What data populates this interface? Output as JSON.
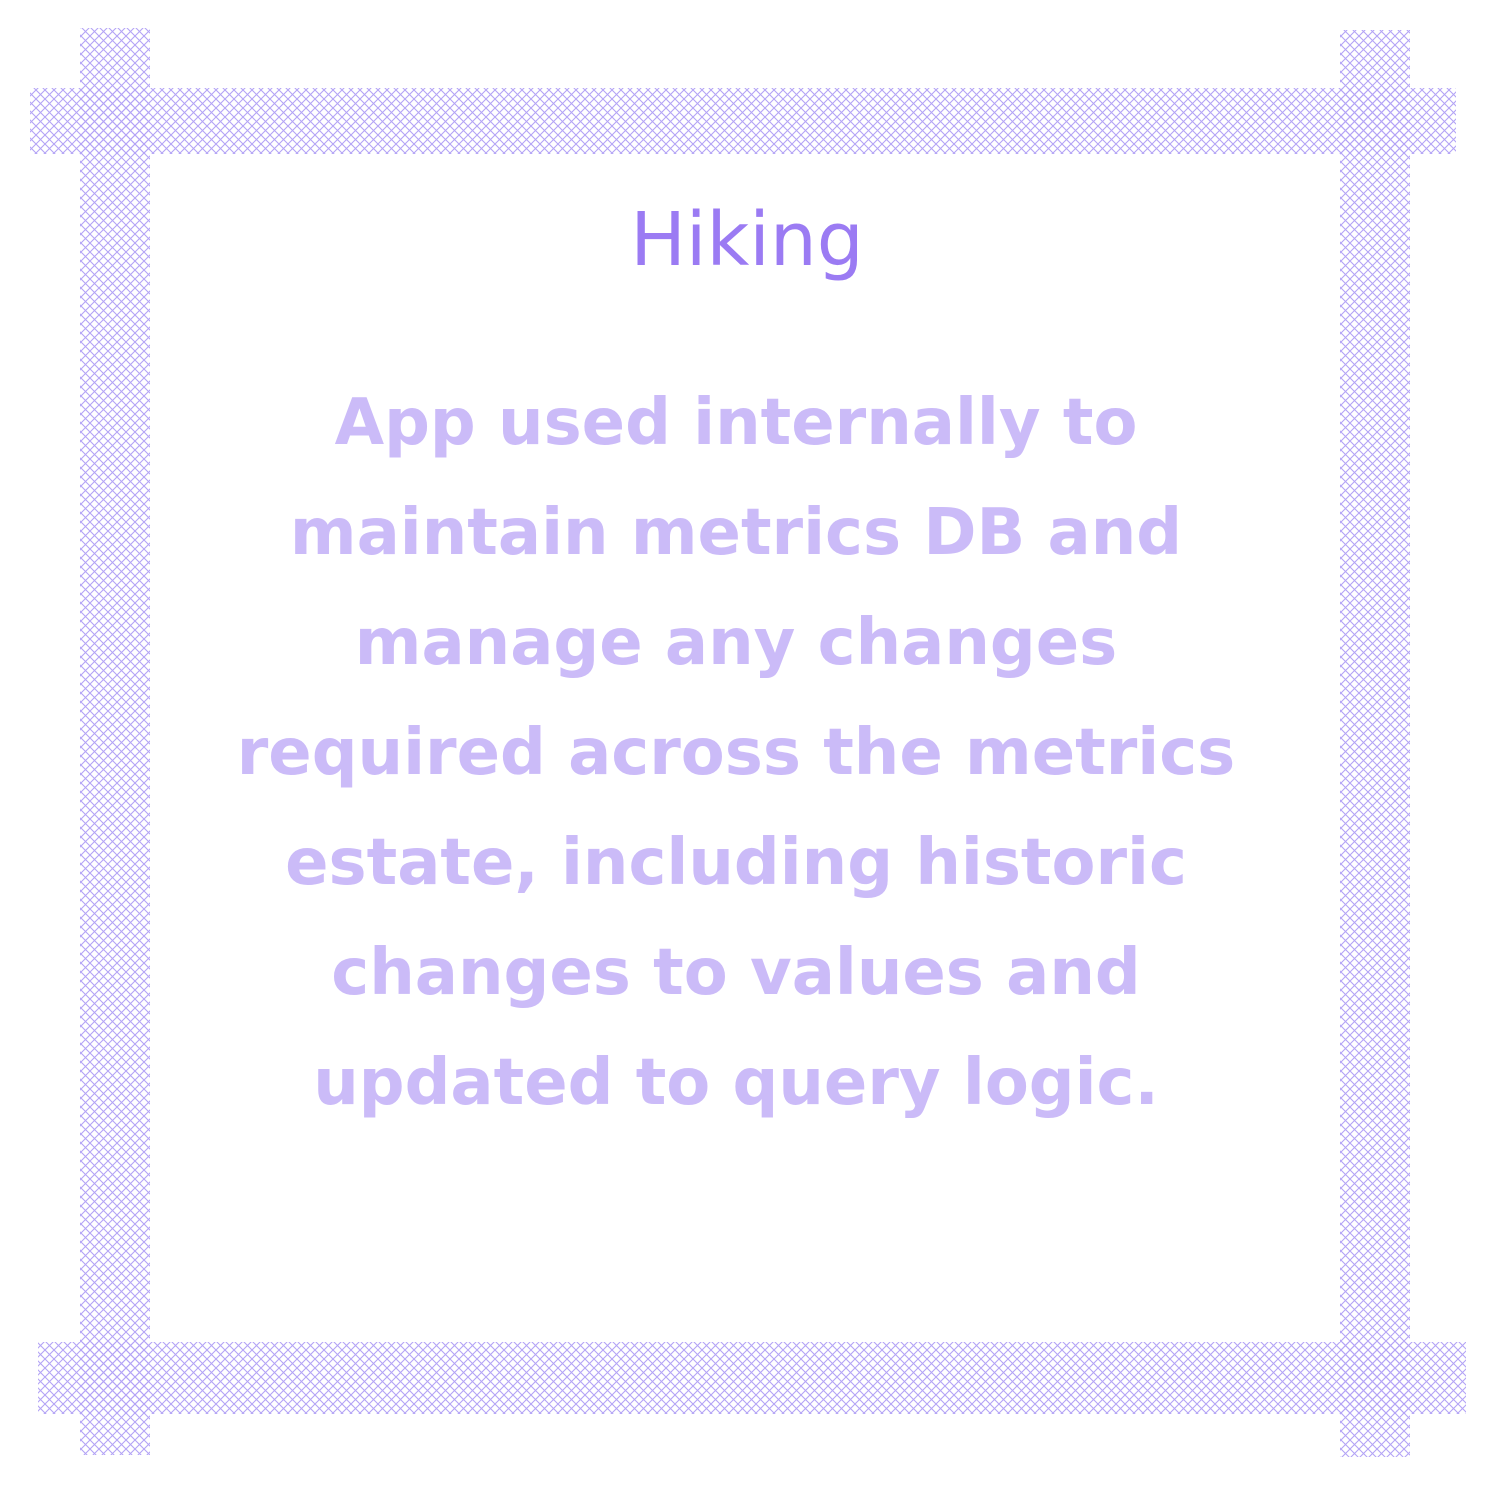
{
  "card": {
    "title": "Hiking",
    "description_lines": [
      "App used internally to",
      "maintain metrics DB and",
      "manage any changes",
      "required across the metrics",
      "estate, including historic",
      "changes to values and",
      "updated to query logic."
    ]
  },
  "colors": {
    "title": "#9b7bf3",
    "body_text": "#cbbbf8",
    "frame_hatch": "#b3a3f6",
    "background": "#ffffff"
  }
}
